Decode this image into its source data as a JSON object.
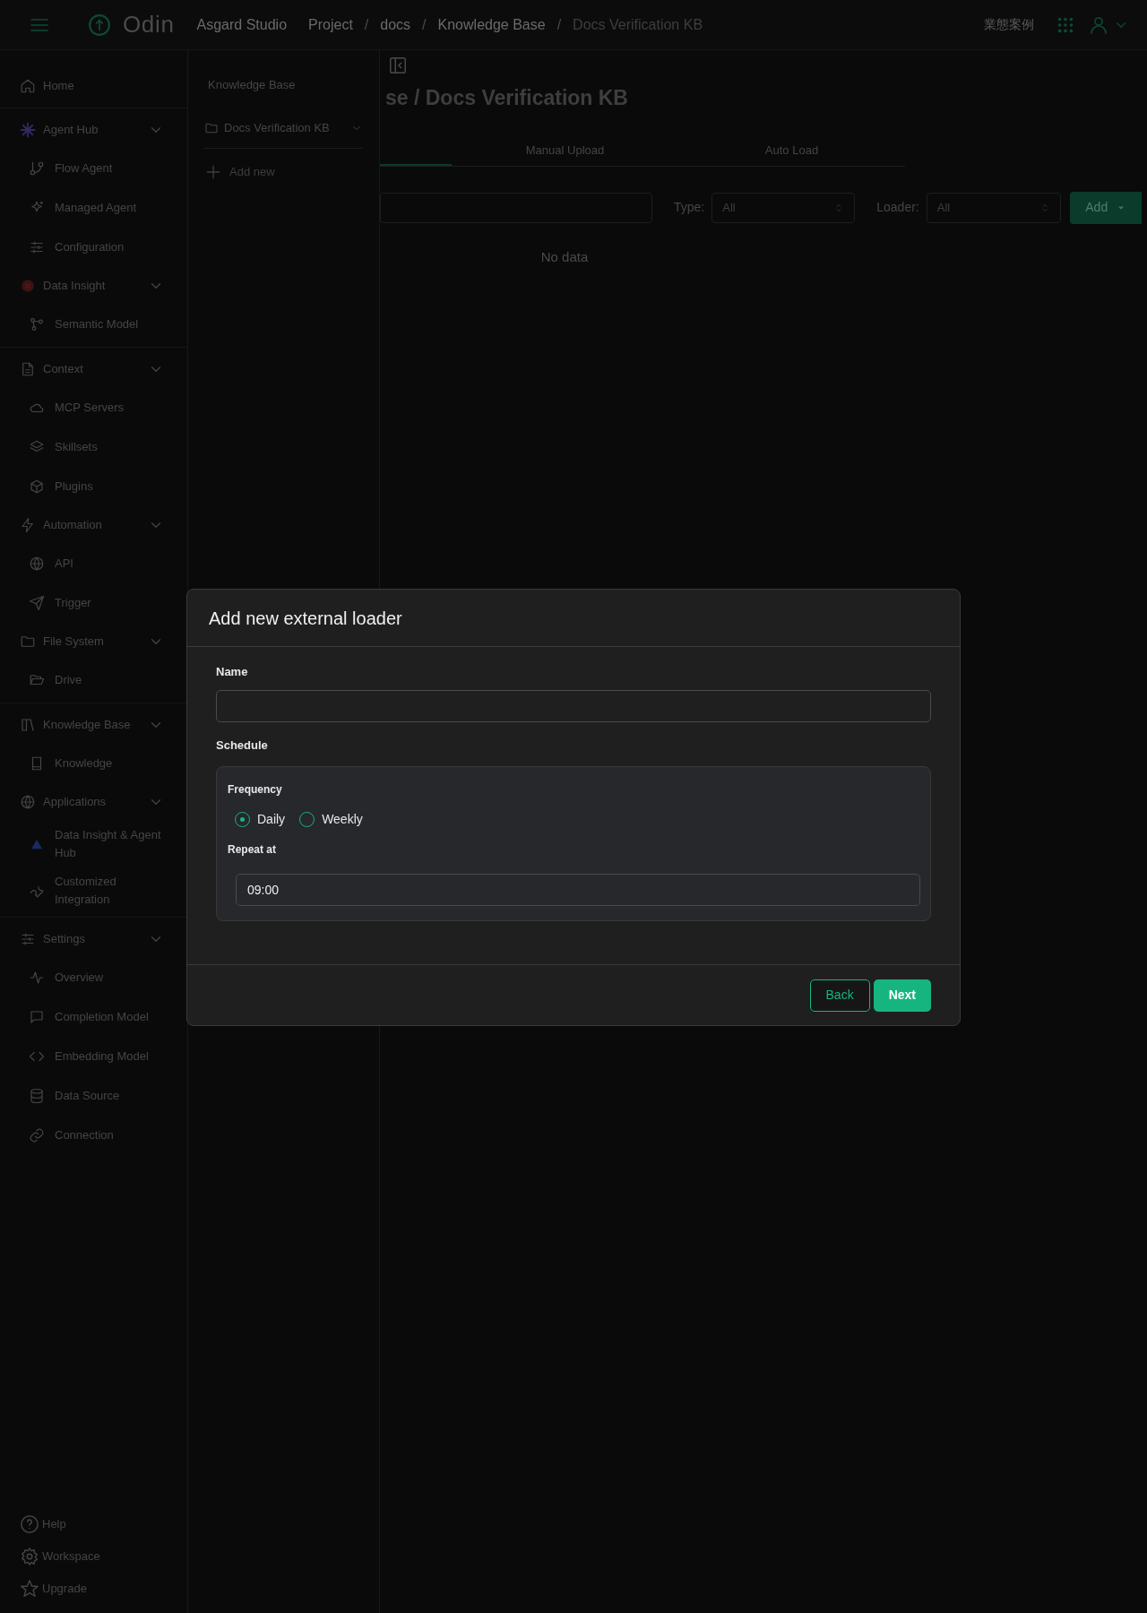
{
  "topbar": {
    "app_name": "Odin",
    "breadcrumb": [
      "Asgard Studio",
      "Project",
      "docs",
      "Knowledge Base",
      "Docs Verification KB"
    ],
    "separator": "/",
    "language": "業態案例"
  },
  "sidebar": {
    "sections": [
      [
        {
          "label": "Home"
        }
      ],
      [
        {
          "label": "Agent Hub",
          "expanded": true,
          "children": [
            {
              "label": "Flow Agent"
            },
            {
              "label": "Managed Agent"
            },
            {
              "label": "Configuration"
            }
          ]
        },
        {
          "label": "Data Insight",
          "expanded": true,
          "children": [
            {
              "label": "Semantic Model"
            }
          ]
        }
      ],
      [
        {
          "label": "Context",
          "expanded": true,
          "children": [
            {
              "label": "MCP Servers"
            },
            {
              "label": "Skillsets"
            },
            {
              "label": "Plugins"
            }
          ]
        },
        {
          "label": "Automation",
          "expanded": true,
          "children": [
            {
              "label": "API"
            },
            {
              "label": "Trigger"
            }
          ]
        },
        {
          "label": "File System",
          "expanded": true,
          "children": [
            {
              "label": "Drive"
            }
          ]
        }
      ],
      [
        {
          "label": "Knowledge Base",
          "expanded": true,
          "children": [
            {
              "label": "Knowledge"
            }
          ]
        },
        {
          "label": "Applications",
          "expanded": true,
          "children": [
            {
              "label": "Data Insight & Agent Hub"
            },
            {
              "label": "Customized Integration"
            }
          ]
        }
      ],
      [
        {
          "label": "Settings",
          "expanded": true,
          "children": [
            {
              "label": "Overview"
            },
            {
              "label": "Completion Model"
            },
            {
              "label": "Embedding Model"
            },
            {
              "label": "Data Source"
            },
            {
              "label": "Connection"
            }
          ]
        }
      ]
    ],
    "footer": [
      "Help",
      "Workspace",
      "Upgrade"
    ]
  },
  "kb_panel": {
    "title": "Knowledge Base",
    "folders": [
      {
        "label": "Docs Verification KB"
      }
    ],
    "add_label": "Add new"
  },
  "main": {
    "title": "se / Docs Verification KB",
    "tabs": [
      {
        "label": "Manual Upload",
        "selected": false
      },
      {
        "label": "Auto Load",
        "selected": false
      }
    ],
    "filters": {
      "type_label": "Type:",
      "type_value": "All",
      "loader_label": "Loader:",
      "loader_value": "All",
      "add_button": "Add"
    },
    "empty_text": "No data"
  },
  "modal": {
    "title": "Add new external loader",
    "name_label": "Name",
    "schedule_label": "Schedule",
    "frequency_label": "Frequency",
    "frequency_options": [
      {
        "label": "Daily",
        "selected": true
      },
      {
        "label": "Weekly",
        "selected": false
      }
    ],
    "repeat_label": "Repeat at",
    "repeat_value": "09:00",
    "back_button": "Back",
    "next_button": "Next"
  }
}
